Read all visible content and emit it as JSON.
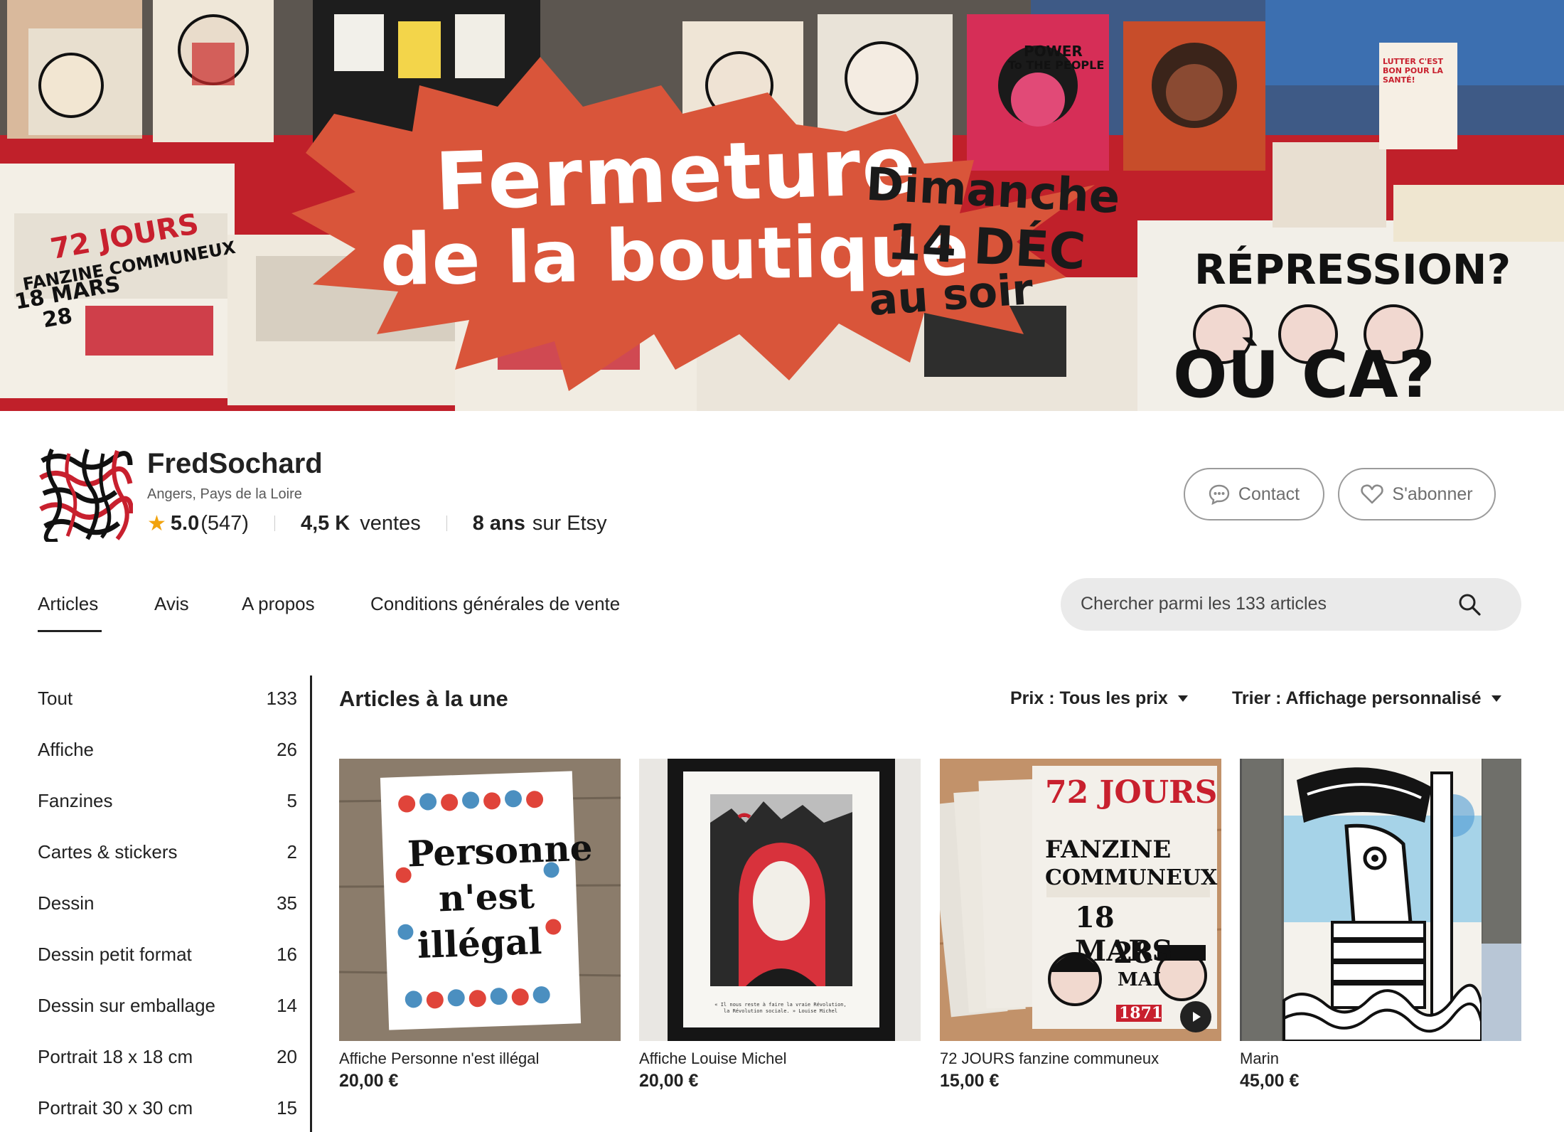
{
  "banner": {
    "line1": "Fermeture",
    "line2": "de la boutique",
    "date1": "Dimanche",
    "date2": "14 DÉC",
    "date3": "au soir",
    "poster_big": "RÉPRESSION?",
    "poster_big2": "OÙ CA?",
    "poster_small1": "POWER",
    "poster_small2": "To THE PEOPLE",
    "poster_small3": "LUTTER C'EST BON POUR LA SANTÉ!",
    "poster_small4": "72 JOURS",
    "poster_small5": "FANZINE COMMUNEUX",
    "poster_small6": "18 MARS",
    "poster_small7": "28"
  },
  "shop": {
    "name": "FredSochard",
    "location": "Angers, Pays de la Loire",
    "rating": "5.0",
    "rating_count": "(547)",
    "sales_value": "4,5 K",
    "sales_label": "ventes",
    "years_value": "8 ans",
    "years_label": "sur Etsy"
  },
  "buttons": {
    "contact": "Contact",
    "follow": "S'abonner"
  },
  "tabs": [
    {
      "label": "Articles",
      "active": true
    },
    {
      "label": "Avis"
    },
    {
      "label": "A propos"
    },
    {
      "label": "Conditions générales de vente"
    }
  ],
  "search": {
    "placeholder": "Chercher parmi les 133 articles"
  },
  "sidebar": {
    "items": [
      {
        "label": "Tout",
        "count": "133"
      },
      {
        "label": "Affiche",
        "count": "26"
      },
      {
        "label": "Fanzines",
        "count": "5"
      },
      {
        "label": "Cartes & stickers",
        "count": "2"
      },
      {
        "label": "Dessin",
        "count": "35"
      },
      {
        "label": "Dessin petit format",
        "count": "16"
      },
      {
        "label": "Dessin sur emballage",
        "count": "14"
      },
      {
        "label": "Portrait 18 x 18 cm",
        "count": "20"
      },
      {
        "label": "Portrait 30 x 30 cm",
        "count": "15"
      }
    ]
  },
  "main": {
    "section_title": "Articles à la une",
    "price_filter": "Prix : Tous les prix",
    "sort_filter": "Trier : Affichage personnalisé",
    "listings": [
      {
        "title": "Affiche Personne n'est illégal",
        "price": "20,00 €",
        "art_line1": "Personne",
        "art_line2": "n'est",
        "art_line3": "illégal"
      },
      {
        "title": "Affiche Louise Michel",
        "price": "20,00 €",
        "caption": "« Il nous reste à faire la vraie Révolution, la Révolution sociale. » Louise Michel"
      },
      {
        "title": "72 JOURS fanzine communeux",
        "price": "15,00 €",
        "art_line1": "72 JOURS",
        "art_line2": "FANZINE",
        "art_line3": "COMMUNEUX",
        "art_line4": "18 MARS",
        "art_line5": "28",
        "art_line6": "MAI",
        "art_line7": "1871"
      },
      {
        "title": "Marin",
        "price": "45,00 €"
      }
    ]
  },
  "colors": {
    "banner_burst": "#d9553a",
    "accent_red": "#c8202e",
    "star": "#f1a30e"
  }
}
